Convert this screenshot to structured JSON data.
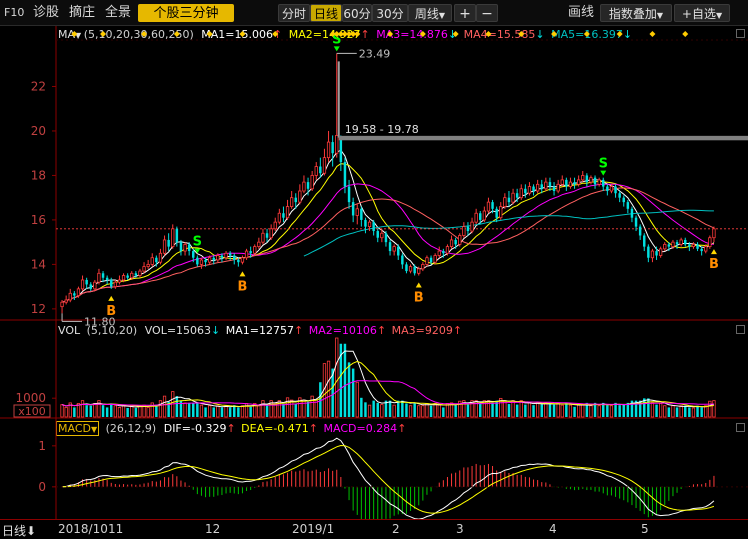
{
  "toolbar": {
    "f10": "F10",
    "diagnose": "诊股",
    "select": "摘庄",
    "full": "全景",
    "stock_minutes": "个股三分钟",
    "periods": [
      "分时",
      "日线",
      "60分",
      "30分",
      "周线"
    ],
    "active_period": "日线",
    "dropdown_icon": "chevron-down-icon",
    "plus": "+",
    "minus": "−",
    "draw_line": "画线",
    "overlay": "指数叠加",
    "add_fav": "+自选"
  },
  "legend_main": {
    "prefix": "MA",
    "params": "(5,10,20,30,60,250)",
    "ma1": "MA1=15.006",
    "ma2": "MA2=14.927",
    "ma3": "MA3=14.876",
    "ma4": "MA4=15.585",
    "ma5": "MA5=16.397"
  },
  "legend_vol": {
    "prefix": "VOL",
    "params": "(5,10,20)",
    "vol": "VOL=15063",
    "ma1": "MA1=12757",
    "ma2": "MA2=10106",
    "ma3": "MA3=9209"
  },
  "legend_macd": {
    "prefix": "MACD",
    "params": "(26,12,9)",
    "dif": "DIF=-0.329",
    "dea": "DEA=-0.471",
    "macd": "MACD=0.284"
  },
  "bottom_bar": {
    "period": "日线",
    "dates": [
      "2018/10",
      "11",
      "12",
      "2019/1",
      "2",
      "3",
      "4",
      "5"
    ]
  },
  "colors": {
    "up": "#ff3a3a",
    "down": "#00e0e0",
    "ma1": "#ffffff",
    "ma2": "#ffff00",
    "ma3": "#ff00ff",
    "ma4": "#ff6060",
    "ma5": "#00c0c0",
    "axis": "#8b0000",
    "signal_s": "#00ff00",
    "signal_b": "#ff8c00",
    "current_price_line": "#ff4040"
  },
  "chart_data": {
    "type": "candlestick",
    "y_ticks": [
      12,
      14,
      16,
      18,
      20,
      22
    ],
    "y_range": [
      11.5,
      24
    ],
    "annotations": {
      "high": "23.49",
      "range": "19.58 - 19.78",
      "low": "11.80"
    },
    "signals": [
      {
        "type": "S",
        "index": 33
      },
      {
        "type": "B",
        "index": 12
      },
      {
        "type": "B",
        "index": 44
      },
      {
        "type": "B",
        "index": 87
      },
      {
        "type": "S",
        "index": 67
      },
      {
        "type": "B",
        "index": 159
      },
      {
        "type": "S",
        "index": 132
      }
    ],
    "candles": [
      [
        12.1,
        12.3,
        11.8,
        12.4
      ],
      [
        12.3,
        12.4,
        12.2,
        12.6
      ],
      [
        12.4,
        12.7,
        12.3,
        12.9
      ],
      [
        12.7,
        12.6,
        12.4,
        12.8
      ],
      [
        12.6,
        12.9,
        12.5,
        13.0
      ],
      [
        12.9,
        13.3,
        12.8,
        13.5
      ],
      [
        13.3,
        13.1,
        12.9,
        13.4
      ],
      [
        13.1,
        12.9,
        12.8,
        13.2
      ],
      [
        12.9,
        13.2,
        12.8,
        13.3
      ],
      [
        13.2,
        13.6,
        13.1,
        13.8
      ],
      [
        13.6,
        13.4,
        13.2,
        13.7
      ],
      [
        13.4,
        13.3,
        13.1,
        13.5
      ],
      [
        13.3,
        13.0,
        12.9,
        13.4
      ],
      [
        13.0,
        13.2,
        12.9,
        13.3
      ],
      [
        13.2,
        13.3,
        13.1,
        13.5
      ],
      [
        13.3,
        13.5,
        13.2,
        13.6
      ],
      [
        13.5,
        13.4,
        13.3,
        13.6
      ],
      [
        13.4,
        13.6,
        13.3,
        13.7
      ],
      [
        13.6,
        13.5,
        13.4,
        13.7
      ],
      [
        13.5,
        13.7,
        13.4,
        13.8
      ],
      [
        13.7,
        13.9,
        13.6,
        14.1
      ],
      [
        13.9,
        14.0,
        13.8,
        14.2
      ],
      [
        14.0,
        14.3,
        13.9,
        14.5
      ],
      [
        14.3,
        14.1,
        13.9,
        14.4
      ],
      [
        14.1,
        14.5,
        14.0,
        14.7
      ],
      [
        14.5,
        15.1,
        14.4,
        15.3
      ],
      [
        15.1,
        14.8,
        14.6,
        15.4
      ],
      [
        14.8,
        15.6,
        14.7,
        15.8
      ],
      [
        15.6,
        15.0,
        14.8,
        15.7
      ],
      [
        15.0,
        14.6,
        14.4,
        15.1
      ],
      [
        14.6,
        14.9,
        14.4,
        15.0
      ],
      [
        14.9,
        14.6,
        14.4,
        15.0
      ],
      [
        14.6,
        14.3,
        14.1,
        14.7
      ],
      [
        14.3,
        14.0,
        13.9,
        14.4
      ],
      [
        14.0,
        14.2,
        13.8,
        14.3
      ],
      [
        14.2,
        14.1,
        13.9,
        14.3
      ],
      [
        14.1,
        14.3,
        14.0,
        14.4
      ],
      [
        14.3,
        14.2,
        14.0,
        14.4
      ],
      [
        14.2,
        14.4,
        14.1,
        14.5
      ],
      [
        14.4,
        14.3,
        14.1,
        14.5
      ],
      [
        14.3,
        14.5,
        14.2,
        14.6
      ],
      [
        14.5,
        14.4,
        14.2,
        14.6
      ],
      [
        14.4,
        14.2,
        14.0,
        14.5
      ],
      [
        14.2,
        14.1,
        13.9,
        14.3
      ],
      [
        14.1,
        14.3,
        14.0,
        14.4
      ],
      [
        14.3,
        14.6,
        14.2,
        14.7
      ],
      [
        14.6,
        14.5,
        14.3,
        14.8
      ],
      [
        14.5,
        14.8,
        14.4,
        14.9
      ],
      [
        14.8,
        15.0,
        14.7,
        15.2
      ],
      [
        15.0,
        15.4,
        14.9,
        15.6
      ],
      [
        15.4,
        15.2,
        15.0,
        15.6
      ],
      [
        15.2,
        15.6,
        15.1,
        15.8
      ],
      [
        15.6,
        15.9,
        15.5,
        16.1
      ],
      [
        15.9,
        16.3,
        15.8,
        16.5
      ],
      [
        16.3,
        16.1,
        15.9,
        16.6
      ],
      [
        16.1,
        16.6,
        16.0,
        16.9
      ],
      [
        16.6,
        17.0,
        16.5,
        17.3
      ],
      [
        17.0,
        16.8,
        16.5,
        17.2
      ],
      [
        16.8,
        17.3,
        16.7,
        17.6
      ],
      [
        17.3,
        17.7,
        17.2,
        18.0
      ],
      [
        17.7,
        17.4,
        17.1,
        17.9
      ],
      [
        17.4,
        18.0,
        17.3,
        18.2
      ],
      [
        18.0,
        18.4,
        17.8,
        18.6
      ],
      [
        18.4,
        18.1,
        17.9,
        18.8
      ],
      [
        18.1,
        18.8,
        18.0,
        19.2
      ],
      [
        18.8,
        19.5,
        18.6,
        20.0
      ],
      [
        19.5,
        19.0,
        18.4,
        19.8
      ],
      [
        19.0,
        19.8,
        18.8,
        23.49
      ],
      [
        19.7,
        18.6,
        18.2,
        19.8
      ],
      [
        18.6,
        17.5,
        17.2,
        18.8
      ],
      [
        17.5,
        16.8,
        16.5,
        17.8
      ],
      [
        16.8,
        16.2,
        15.9,
        17.0
      ],
      [
        16.2,
        16.5,
        15.8,
        16.7
      ],
      [
        16.5,
        16.0,
        15.7,
        16.6
      ],
      [
        16.0,
        15.7,
        15.4,
        16.1
      ],
      [
        15.7,
        15.9,
        15.5,
        16.0
      ],
      [
        15.9,
        15.5,
        15.3,
        16.0
      ],
      [
        15.5,
        15.2,
        15.0,
        15.6
      ],
      [
        15.2,
        15.4,
        15.0,
        15.6
      ],
      [
        15.4,
        15.0,
        14.8,
        15.5
      ],
      [
        15.0,
        14.6,
        14.4,
        15.1
      ],
      [
        14.6,
        14.8,
        14.4,
        14.9
      ],
      [
        14.8,
        14.4,
        14.2,
        14.9
      ],
      [
        14.4,
        14.0,
        13.8,
        14.5
      ],
      [
        14.0,
        13.7,
        13.6,
        14.1
      ],
      [
        13.7,
        13.9,
        13.6,
        14.0
      ],
      [
        13.9,
        13.6,
        13.5,
        14.0
      ],
      [
        13.6,
        13.8,
        13.5,
        13.9
      ],
      [
        13.8,
        14.0,
        13.7,
        14.1
      ],
      [
        14.0,
        14.3,
        13.9,
        14.4
      ],
      [
        14.3,
        14.1,
        14.0,
        14.4
      ],
      [
        14.1,
        14.4,
        14.0,
        14.5
      ],
      [
        14.4,
        14.6,
        14.3,
        14.8
      ],
      [
        14.6,
        14.5,
        14.3,
        14.7
      ],
      [
        14.5,
        14.8,
        14.4,
        14.9
      ],
      [
        14.8,
        15.1,
        14.7,
        15.3
      ],
      [
        15.1,
        14.9,
        14.7,
        15.2
      ],
      [
        14.9,
        15.3,
        14.8,
        15.4
      ],
      [
        15.3,
        15.7,
        15.2,
        15.9
      ],
      [
        15.7,
        15.5,
        15.3,
        15.9
      ],
      [
        15.5,
        15.9,
        15.4,
        16.1
      ],
      [
        15.9,
        16.3,
        15.8,
        16.5
      ],
      [
        16.3,
        16.0,
        15.8,
        16.4
      ],
      [
        16.0,
        16.4,
        15.9,
        16.6
      ],
      [
        16.4,
        16.8,
        16.3,
        17.0
      ],
      [
        16.8,
        16.5,
        16.3,
        16.9
      ],
      [
        16.5,
        16.1,
        15.9,
        16.6
      ],
      [
        16.1,
        16.6,
        16.0,
        16.8
      ],
      [
        16.6,
        17.0,
        16.5,
        17.2
      ],
      [
        17.0,
        16.8,
        16.6,
        17.3
      ],
      [
        16.8,
        17.2,
        16.7,
        17.4
      ],
      [
        17.2,
        17.0,
        16.8,
        17.4
      ],
      [
        17.0,
        17.4,
        16.9,
        17.6
      ],
      [
        17.4,
        17.2,
        17.0,
        17.6
      ],
      [
        17.2,
        17.5,
        17.1,
        17.7
      ],
      [
        17.5,
        17.3,
        17.1,
        17.6
      ],
      [
        17.3,
        17.6,
        17.2,
        17.8
      ],
      [
        17.6,
        17.4,
        17.2,
        17.8
      ],
      [
        17.4,
        17.7,
        17.3,
        17.9
      ],
      [
        17.7,
        17.5,
        17.3,
        17.9
      ],
      [
        17.5,
        17.3,
        17.1,
        17.7
      ],
      [
        17.3,
        17.6,
        17.2,
        17.8
      ],
      [
        17.6,
        17.8,
        17.5,
        18.0
      ],
      [
        17.8,
        17.5,
        17.3,
        17.9
      ],
      [
        17.5,
        17.7,
        17.4,
        17.9
      ],
      [
        17.7,
        17.6,
        17.4,
        17.9
      ],
      [
        17.6,
        17.8,
        17.5,
        18.0
      ],
      [
        17.8,
        18.0,
        17.7,
        18.2
      ],
      [
        18.0,
        17.7,
        17.5,
        18.1
      ],
      [
        17.7,
        17.9,
        17.6,
        18.0
      ],
      [
        17.9,
        17.6,
        17.4,
        18.0
      ],
      [
        17.6,
        17.8,
        17.5,
        17.9
      ],
      [
        17.8,
        17.5,
        17.3,
        17.9
      ],
      [
        17.5,
        17.3,
        17.1,
        17.6
      ],
      [
        17.3,
        17.5,
        17.2,
        17.6
      ],
      [
        17.5,
        17.2,
        17.0,
        17.6
      ],
      [
        17.2,
        17.0,
        16.8,
        17.3
      ],
      [
        17.0,
        16.8,
        16.6,
        17.1
      ],
      [
        16.8,
        16.5,
        16.3,
        16.9
      ],
      [
        16.5,
        16.1,
        15.9,
        16.6
      ],
      [
        16.1,
        15.7,
        15.5,
        16.2
      ],
      [
        15.7,
        15.3,
        15.1,
        15.8
      ],
      [
        15.3,
        14.8,
        14.6,
        15.4
      ],
      [
        14.8,
        14.3,
        14.1,
        14.9
      ],
      [
        14.3,
        14.6,
        14.1,
        14.7
      ],
      [
        14.6,
        14.4,
        14.2,
        14.8
      ],
      [
        14.4,
        14.7,
        14.3,
        14.8
      ],
      [
        14.7,
        14.9,
        14.6,
        15.0
      ],
      [
        14.9,
        14.8,
        14.6,
        15.0
      ],
      [
        14.8,
        15.0,
        14.7,
        15.1
      ],
      [
        15.0,
        14.9,
        14.7,
        15.1
      ],
      [
        14.9,
        15.1,
        14.8,
        15.2
      ],
      [
        15.1,
        14.9,
        14.8,
        15.2
      ],
      [
        14.9,
        14.8,
        14.6,
        15.0
      ],
      [
        14.8,
        14.9,
        14.7,
        15.0
      ],
      [
        14.9,
        14.7,
        14.6,
        15.0
      ],
      [
        14.7,
        14.6,
        14.4,
        14.8
      ],
      [
        14.6,
        14.8,
        14.5,
        14.9
      ],
      [
        14.8,
        15.2,
        14.7,
        15.3
      ],
      [
        15.2,
        15.6,
        15.0,
        15.7
      ]
    ]
  }
}
